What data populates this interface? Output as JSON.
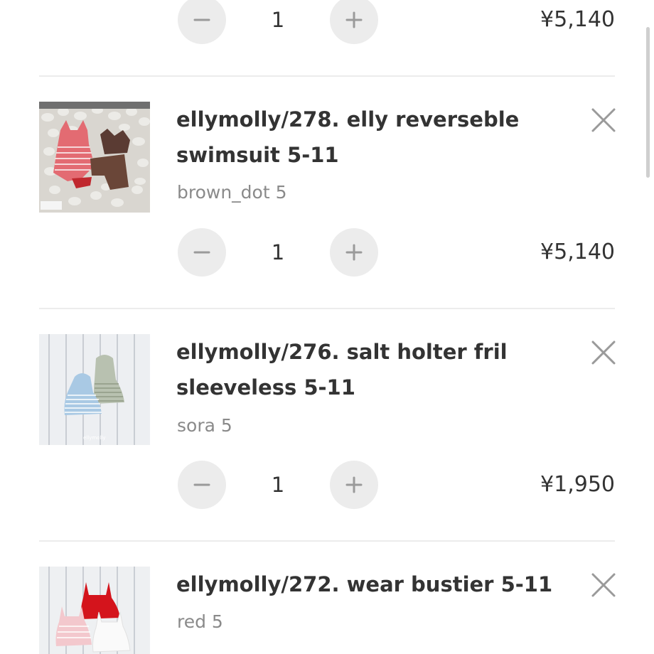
{
  "cart": {
    "items": [
      {
        "title": "",
        "variant": "",
        "quantity": "1",
        "price": "¥5,140",
        "image": "",
        "partial": true
      },
      {
        "title": "ellymolly/278. elly reverseble swimsuit 5-11",
        "variant": "brown_dot 5",
        "quantity": "1",
        "price": "¥5,140",
        "image": "swimsuit-photo"
      },
      {
        "title": "ellymolly/276. salt holter fril sleeveless 5-11",
        "variant": "sora 5",
        "quantity": "1",
        "price": "¥1,950",
        "image": "sleeveless-top-photo"
      },
      {
        "title": "ellymolly/272. wear bustier 5-11",
        "variant": "red 5",
        "quantity": "",
        "price": "",
        "image": "bustier-photo"
      }
    ]
  },
  "icons": {
    "decrease": "minus-icon",
    "increase": "plus-icon",
    "remove": "close-icon"
  },
  "colors": {
    "text": "#333333",
    "muted": "#8a8a8a",
    "button_bg": "#ececec",
    "divider": "#ececec",
    "icon": "#9a9a9a"
  }
}
